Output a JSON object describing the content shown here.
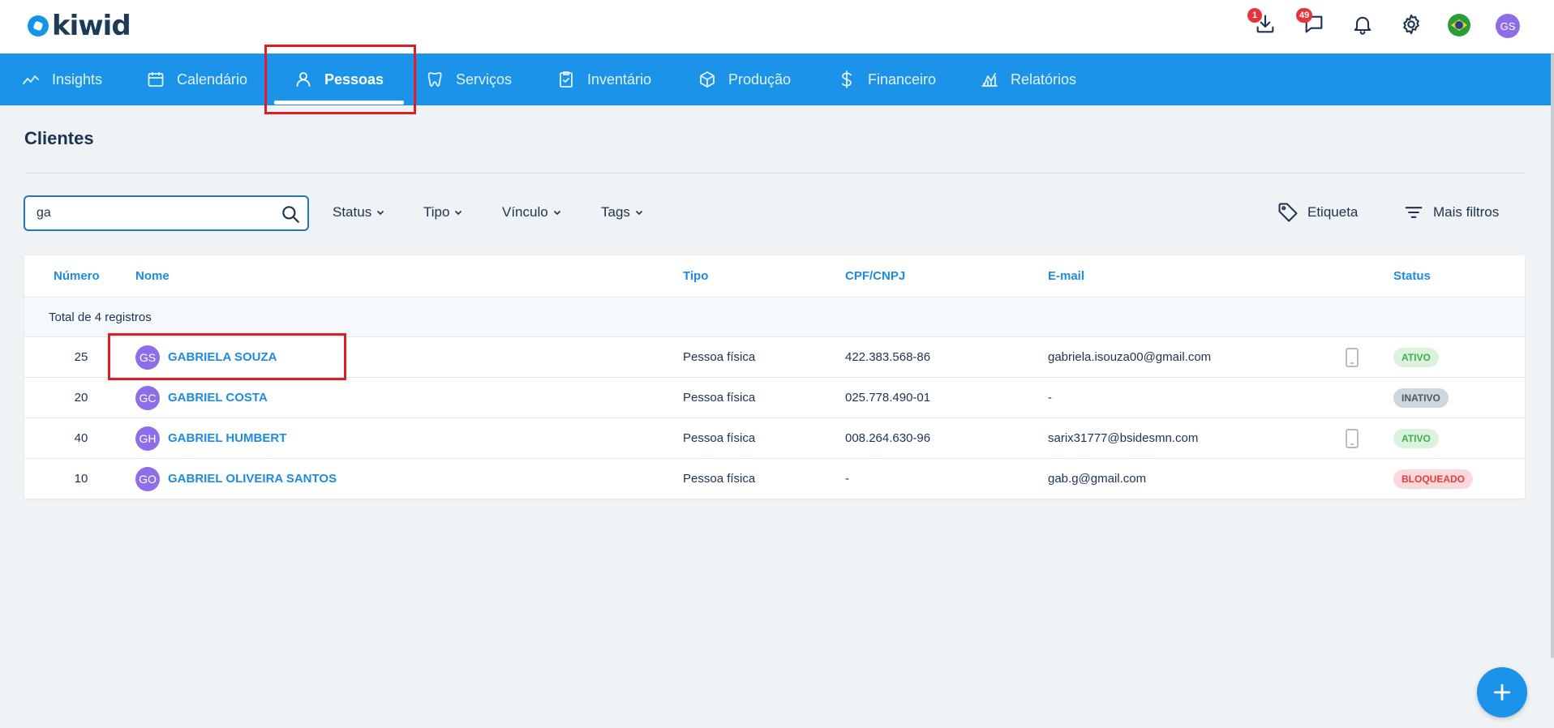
{
  "app": {
    "logo_text": "kiwid"
  },
  "topbar": {
    "download_badge": "1",
    "messages_badge": "49",
    "user_initials": "GS",
    "icons": [
      "download-icon",
      "chat-icon",
      "bell-icon",
      "gear-icon",
      "brazil-flag-icon",
      "avatar"
    ]
  },
  "nav": {
    "items": [
      {
        "label": "Insights",
        "icon": "chart-line-icon"
      },
      {
        "label": "Calendário",
        "icon": "calendar-icon"
      },
      {
        "label": "Pessoas",
        "icon": "person-icon",
        "active": true
      },
      {
        "label": "Serviços",
        "icon": "tooth-icon"
      },
      {
        "label": "Inventário",
        "icon": "clipboard-check-icon"
      },
      {
        "label": "Produção",
        "icon": "box-icon"
      },
      {
        "label": "Financeiro",
        "icon": "dollar-icon"
      },
      {
        "label": "Relatórios",
        "icon": "report-icon"
      }
    ],
    "accent_color": "#1a93e8"
  },
  "page": {
    "title": "Clientes"
  },
  "filters": {
    "search_value": "ga",
    "status_label": "Status",
    "tipo_label": "Tipo",
    "vinculo_label": "Vínculo",
    "tags_label": "Tags",
    "etiqueta_label": "Etiqueta",
    "mais_filtros_label": "Mais filtros"
  },
  "table": {
    "headers": {
      "numero": "Número",
      "nome": "Nome",
      "tipo": "Tipo",
      "cpf": "CPF/CNPJ",
      "email": "E-mail",
      "status": "Status"
    },
    "total_label": "Total de 4 registros",
    "rows": [
      {
        "numero": "25",
        "initials": "GS",
        "nome": "GABRIELA SOUZA",
        "tipo": "Pessoa física",
        "cpf": "422.383.568-86",
        "email": "gabriela.isouza00@gmail.com",
        "has_phone": true,
        "status": "ATIVO"
      },
      {
        "numero": "20",
        "initials": "GC",
        "nome": "GABRIEL COSTA",
        "tipo": "Pessoa física",
        "cpf": "025.778.490-01",
        "email": "-",
        "has_phone": false,
        "status": "INATIVO"
      },
      {
        "numero": "40",
        "initials": "GH",
        "nome": "GABRIEL HUMBERT",
        "tipo": "Pessoa física",
        "cpf": "008.264.630-96",
        "email": "sarix31777@bsidesmn.com",
        "has_phone": true,
        "status": "ATIVO"
      },
      {
        "numero": "10",
        "initials": "GO",
        "nome": "GABRIEL OLIVEIRA SANTOS",
        "tipo": "Pessoa física",
        "cpf": "-",
        "email": "gab.g@gmail.com",
        "has_phone": false,
        "status": "BLOQUEADO"
      }
    ]
  },
  "status_colors": {
    "ATIVO": "#3fae4f",
    "INATIVO": "#4b5a68",
    "BLOQUEADO": "#e03c41"
  },
  "highlight_color": "#e01d24"
}
